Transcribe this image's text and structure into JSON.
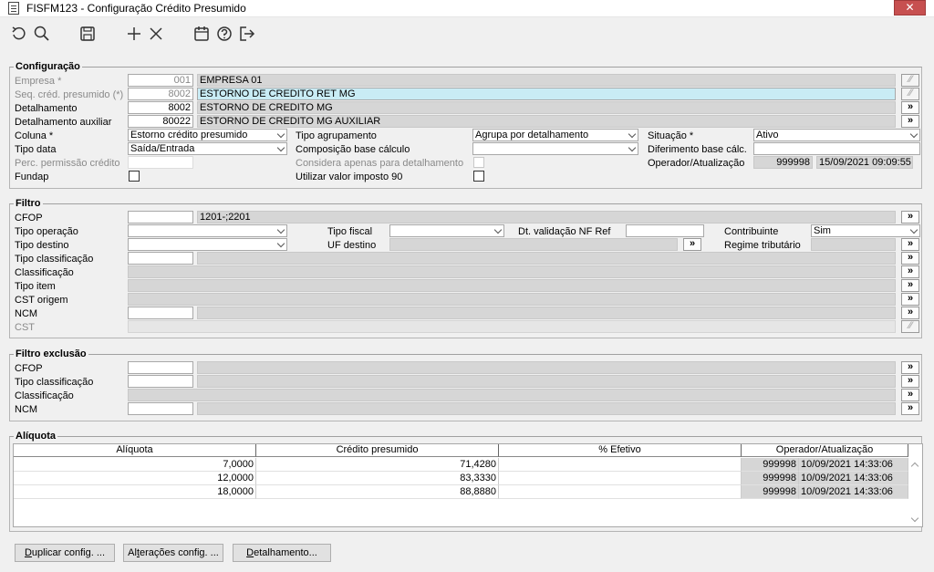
{
  "window": {
    "title": "FISFM123 - Configuração Crédito Presumido",
    "close": "✕"
  },
  "toolbar": {
    "icons": [
      "undo-icon",
      "search-icon",
      "save-icon",
      "add-icon",
      "delete-icon",
      "calendar-icon",
      "help-icon",
      "exit-icon"
    ]
  },
  "config": {
    "title": "Configuração",
    "empresa": {
      "label": "Empresa *",
      "code": "001",
      "name": "EMPRESA 01"
    },
    "seq": {
      "label": "Seq. créd. presumido (*)",
      "code": "8002",
      "name": "ESTORNO DE CREDITO RET MG"
    },
    "detalhamento": {
      "label": "Detalhamento",
      "code": "8002",
      "name": "ESTORNO DE CREDITO MG"
    },
    "det_aux": {
      "label": "Detalhamento auxiliar",
      "code": "80022",
      "name": "ESTORNO DE CREDITO MG AUXILIAR"
    },
    "coluna": {
      "label": "Coluna *",
      "value": "Estorno crédito presumido"
    },
    "tipo_data": {
      "label": "Tipo data",
      "value": "Saída/Entrada"
    },
    "perc": {
      "label": "Perc. permissão crédito",
      "value": ""
    },
    "fundap": {
      "label": "Fundap"
    },
    "tipo_agrup": {
      "label": "Tipo agrupamento",
      "value": "Agrupa por detalhamento"
    },
    "comp_base": {
      "label": "Composição base cálculo",
      "value": ""
    },
    "considera": {
      "label": "Considera apenas para detalhamento"
    },
    "utilizar": {
      "label": "Utilizar valor imposto 90"
    },
    "situacao": {
      "label": "Situação *",
      "value": "Ativo"
    },
    "diferimento": {
      "label": "Diferimento base cálc.",
      "value": ""
    },
    "operador": {
      "label": "Operador/Atualização",
      "user": "999998",
      "date": "15/09/2021 09:09:55"
    }
  },
  "filtro": {
    "title": "Filtro",
    "cfop": {
      "label": "CFOP",
      "value": "",
      "desc": "1201-;2201"
    },
    "tipo_operacao": {
      "label": "Tipo operação"
    },
    "tipo_destino": {
      "label": "Tipo destino"
    },
    "tipo_fiscal": {
      "label": "Tipo fiscal"
    },
    "uf_destino": {
      "label": "UF destino"
    },
    "dt_validacao": {
      "label": "Dt. validação NF Ref",
      "value": ""
    },
    "contribuinte": {
      "label": "Contribuinte",
      "value": "Sim"
    },
    "regime": {
      "label": "Regime tributário"
    },
    "tipo_classificacao": {
      "label": "Tipo classificação"
    },
    "classificacao": {
      "label": "Classificação"
    },
    "tipo_item": {
      "label": "Tipo item"
    },
    "cst_origem": {
      "label": "CST origem"
    },
    "ncm": {
      "label": "NCM"
    },
    "cst": {
      "label": "CST"
    }
  },
  "filtro_exclusao": {
    "title": "Filtro exclusão",
    "cfop": {
      "label": "CFOP"
    },
    "tipo_classificacao": {
      "label": "Tipo classificação"
    },
    "classificacao": {
      "label": "Classificação"
    },
    "ncm": {
      "label": "NCM"
    }
  },
  "aliquota": {
    "title": "Alíquota",
    "columns": [
      "Alíquota",
      "Crédito presumido",
      "% Efetivo",
      "Operador/Atualização"
    ],
    "rows": [
      {
        "aliquota": "7,0000",
        "credito": "71,4280",
        "efetivo": "",
        "user": "999998",
        "date": "10/09/2021 14:33:06"
      },
      {
        "aliquota": "12,0000",
        "credito": "83,3330",
        "efetivo": "",
        "user": "999998",
        "date": "10/09/2021 14:33:06"
      },
      {
        "aliquota": "18,0000",
        "credito": "88,8880",
        "efetivo": "",
        "user": "999998",
        "date": "10/09/2021 14:33:06"
      }
    ]
  },
  "buttons": {
    "duplicar": {
      "pre": "D",
      "rest": "uplicar config. ..."
    },
    "alteracoes": {
      "pre": "Al",
      "u": "t",
      "rest": "erações config. ..."
    },
    "detalhamento": {
      "u": "D",
      "rest": "etalhamento..."
    }
  },
  "glyphs": {
    "lookup": "»",
    "lookup_dis": "⁄⁄"
  }
}
